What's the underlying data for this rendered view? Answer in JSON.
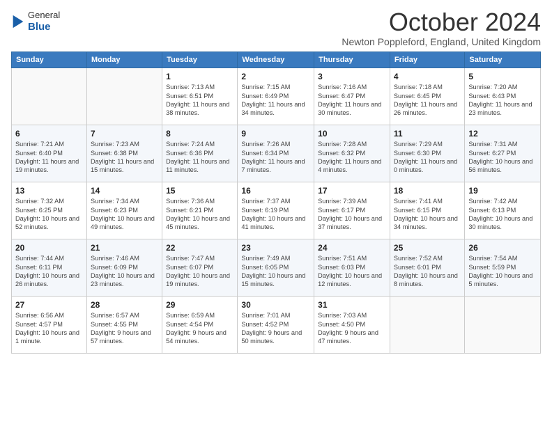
{
  "header": {
    "logo_line1": "General",
    "logo_line2": "Blue",
    "title": "October 2024",
    "subtitle": "Newton Poppleford, England, United Kingdom"
  },
  "days_of_week": [
    "Sunday",
    "Monday",
    "Tuesday",
    "Wednesday",
    "Thursday",
    "Friday",
    "Saturday"
  ],
  "weeks": [
    [
      {
        "day": "",
        "info": ""
      },
      {
        "day": "",
        "info": ""
      },
      {
        "day": "1",
        "info": "Sunrise: 7:13 AM\nSunset: 6:51 PM\nDaylight: 11 hours and 38 minutes."
      },
      {
        "day": "2",
        "info": "Sunrise: 7:15 AM\nSunset: 6:49 PM\nDaylight: 11 hours and 34 minutes."
      },
      {
        "day": "3",
        "info": "Sunrise: 7:16 AM\nSunset: 6:47 PM\nDaylight: 11 hours and 30 minutes."
      },
      {
        "day": "4",
        "info": "Sunrise: 7:18 AM\nSunset: 6:45 PM\nDaylight: 11 hours and 26 minutes."
      },
      {
        "day": "5",
        "info": "Sunrise: 7:20 AM\nSunset: 6:43 PM\nDaylight: 11 hours and 23 minutes."
      }
    ],
    [
      {
        "day": "6",
        "info": "Sunrise: 7:21 AM\nSunset: 6:40 PM\nDaylight: 11 hours and 19 minutes."
      },
      {
        "day": "7",
        "info": "Sunrise: 7:23 AM\nSunset: 6:38 PM\nDaylight: 11 hours and 15 minutes."
      },
      {
        "day": "8",
        "info": "Sunrise: 7:24 AM\nSunset: 6:36 PM\nDaylight: 11 hours and 11 minutes."
      },
      {
        "day": "9",
        "info": "Sunrise: 7:26 AM\nSunset: 6:34 PM\nDaylight: 11 hours and 7 minutes."
      },
      {
        "day": "10",
        "info": "Sunrise: 7:28 AM\nSunset: 6:32 PM\nDaylight: 11 hours and 4 minutes."
      },
      {
        "day": "11",
        "info": "Sunrise: 7:29 AM\nSunset: 6:30 PM\nDaylight: 11 hours and 0 minutes."
      },
      {
        "day": "12",
        "info": "Sunrise: 7:31 AM\nSunset: 6:27 PM\nDaylight: 10 hours and 56 minutes."
      }
    ],
    [
      {
        "day": "13",
        "info": "Sunrise: 7:32 AM\nSunset: 6:25 PM\nDaylight: 10 hours and 52 minutes."
      },
      {
        "day": "14",
        "info": "Sunrise: 7:34 AM\nSunset: 6:23 PM\nDaylight: 10 hours and 49 minutes."
      },
      {
        "day": "15",
        "info": "Sunrise: 7:36 AM\nSunset: 6:21 PM\nDaylight: 10 hours and 45 minutes."
      },
      {
        "day": "16",
        "info": "Sunrise: 7:37 AM\nSunset: 6:19 PM\nDaylight: 10 hours and 41 minutes."
      },
      {
        "day": "17",
        "info": "Sunrise: 7:39 AM\nSunset: 6:17 PM\nDaylight: 10 hours and 37 minutes."
      },
      {
        "day": "18",
        "info": "Sunrise: 7:41 AM\nSunset: 6:15 PM\nDaylight: 10 hours and 34 minutes."
      },
      {
        "day": "19",
        "info": "Sunrise: 7:42 AM\nSunset: 6:13 PM\nDaylight: 10 hours and 30 minutes."
      }
    ],
    [
      {
        "day": "20",
        "info": "Sunrise: 7:44 AM\nSunset: 6:11 PM\nDaylight: 10 hours and 26 minutes."
      },
      {
        "day": "21",
        "info": "Sunrise: 7:46 AM\nSunset: 6:09 PM\nDaylight: 10 hours and 23 minutes."
      },
      {
        "day": "22",
        "info": "Sunrise: 7:47 AM\nSunset: 6:07 PM\nDaylight: 10 hours and 19 minutes."
      },
      {
        "day": "23",
        "info": "Sunrise: 7:49 AM\nSunset: 6:05 PM\nDaylight: 10 hours and 15 minutes."
      },
      {
        "day": "24",
        "info": "Sunrise: 7:51 AM\nSunset: 6:03 PM\nDaylight: 10 hours and 12 minutes."
      },
      {
        "day": "25",
        "info": "Sunrise: 7:52 AM\nSunset: 6:01 PM\nDaylight: 10 hours and 8 minutes."
      },
      {
        "day": "26",
        "info": "Sunrise: 7:54 AM\nSunset: 5:59 PM\nDaylight: 10 hours and 5 minutes."
      }
    ],
    [
      {
        "day": "27",
        "info": "Sunrise: 6:56 AM\nSunset: 4:57 PM\nDaylight: 10 hours and 1 minute."
      },
      {
        "day": "28",
        "info": "Sunrise: 6:57 AM\nSunset: 4:55 PM\nDaylight: 9 hours and 57 minutes."
      },
      {
        "day": "29",
        "info": "Sunrise: 6:59 AM\nSunset: 4:54 PM\nDaylight: 9 hours and 54 minutes."
      },
      {
        "day": "30",
        "info": "Sunrise: 7:01 AM\nSunset: 4:52 PM\nDaylight: 9 hours and 50 minutes."
      },
      {
        "day": "31",
        "info": "Sunrise: 7:03 AM\nSunset: 4:50 PM\nDaylight: 9 hours and 47 minutes."
      },
      {
        "day": "",
        "info": ""
      },
      {
        "day": "",
        "info": ""
      }
    ]
  ]
}
